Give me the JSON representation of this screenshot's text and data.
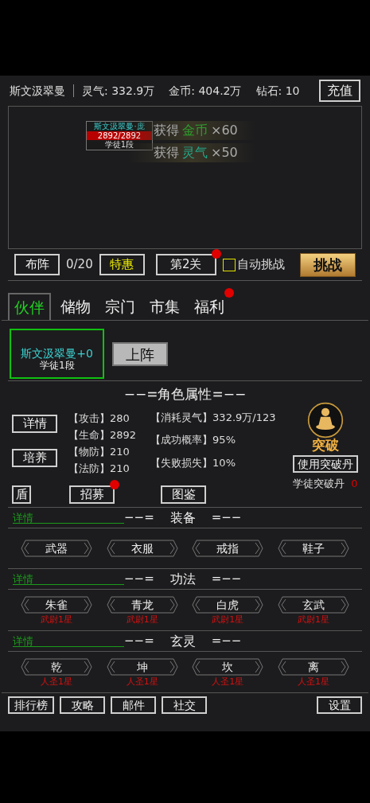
{
  "header": {
    "player": "斯文汲翠曼",
    "resources": [
      "灵气: 332.9万",
      "金币: 404.2万",
      "钻石: 10"
    ],
    "recharge": "充值"
  },
  "battle": {
    "unit": {
      "name": "斯文汲翠曼·庞",
      "hp": "2892/2892",
      "level": 1,
      "rank": "学徒1段"
    },
    "rewards": [
      {
        "prefix": "获得",
        "item": "金币",
        "color": "#2e9e2e",
        "amount": "×60"
      },
      {
        "prefix": "获得",
        "item": "灵气",
        "color": "#22a88a",
        "amount": "×50"
      }
    ]
  },
  "controls": {
    "formation": "布阵",
    "count": "0/20",
    "deal": "特惠",
    "stage": "第2关",
    "stage_badge": true,
    "auto": {
      "label": "自动挑战",
      "checked": false
    },
    "challenge": "挑战"
  },
  "tabs": [
    {
      "label": "伙伴",
      "selected": true,
      "badge": false
    },
    {
      "label": "储物",
      "selected": false,
      "badge": false
    },
    {
      "label": "宗门",
      "selected": false,
      "badge": false
    },
    {
      "label": "市集",
      "selected": false,
      "badge": false
    },
    {
      "label": "福利",
      "selected": false,
      "badge": true
    }
  ],
  "partner": {
    "name": "斯文汲翠曼+0",
    "rank": "学徒1段",
    "selected": true,
    "deploy": "上阵"
  },
  "attributes": {
    "title": "−−=角色属性=−−",
    "buttons": [
      "详情",
      "培养"
    ],
    "stats": [
      {
        "label": "【攻击】",
        "value": "280"
      },
      {
        "label": "【生命】",
        "value": "2892"
      },
      {
        "label": "【物防】",
        "value": "210"
      },
      {
        "label": "【法防】",
        "value": "210"
      }
    ],
    "breakthrough": [
      {
        "label": "【消耗灵气】",
        "value": "332.9万/123"
      },
      {
        "label": "【成功概率】",
        "value": "95%"
      },
      {
        "label": "【失败损失】",
        "value": "10%"
      }
    ],
    "break_label": "突破",
    "use_pill": "使用突破丹",
    "pill_label": "学徒突破丹",
    "pill_count": "0",
    "actions": [
      {
        "label": "盾",
        "badge": false
      },
      {
        "label": "招募",
        "badge": true
      },
      {
        "label": "图鉴",
        "badge": false
      }
    ]
  },
  "sections": [
    {
      "detail": "详情",
      "left": "−−=",
      "title": "装备",
      "right": "=−−",
      "slots": [
        {
          "name": "武器"
        },
        {
          "name": "衣服"
        },
        {
          "name": "戒指"
        },
        {
          "name": "鞋子"
        }
      ]
    },
    {
      "detail": "详情",
      "left": "−−=",
      "title": "功法",
      "right": "=−−",
      "slots": [
        {
          "name": "朱雀",
          "grade": "武尉1星"
        },
        {
          "name": "青龙",
          "grade": "武尉1星"
        },
        {
          "name": "白虎",
          "grade": "武尉1星"
        },
        {
          "name": "玄武",
          "grade": "武尉1星"
        }
      ]
    },
    {
      "detail": "详情",
      "left": "−−=",
      "title": "玄灵",
      "right": "=−−",
      "slots": [
        {
          "name": "乾",
          "grade": "人圣1星"
        },
        {
          "name": "坤",
          "grade": "人圣1星"
        },
        {
          "name": "坎",
          "grade": "人圣1星"
        },
        {
          "name": "离",
          "grade": "人圣1星"
        }
      ]
    }
  ],
  "bottom_left": [
    "排行榜",
    "攻略",
    "邮件",
    "社交"
  ],
  "bottom_right": "设置"
}
